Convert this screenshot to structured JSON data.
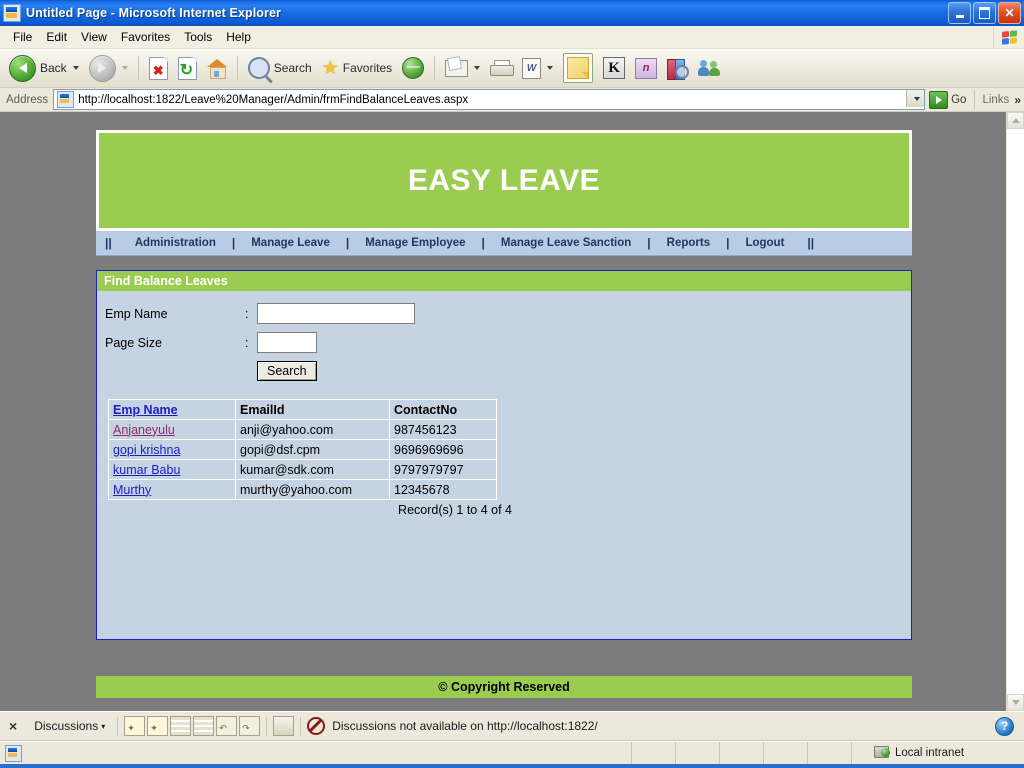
{
  "window": {
    "title": "Untitled Page - Microsoft Internet Explorer",
    "minimize_label": "Minimize",
    "maximize_label": "Maximize",
    "close_label": "Close"
  },
  "menu": {
    "items": [
      "File",
      "Edit",
      "View",
      "Favorites",
      "Tools",
      "Help"
    ]
  },
  "toolbar": {
    "back_label": "Back",
    "search_label": "Search",
    "favorites_label": "Favorites"
  },
  "address": {
    "label": "Address",
    "value": "http://localhost:1822/Leave%20Manager/Admin/frmFindBalanceLeaves.aspx",
    "placeholder": "",
    "go_label": "Go",
    "links_label": "Links",
    "chevron": "»"
  },
  "site": {
    "banner_title": "EASY LEAVE",
    "nav": {
      "start_marker": "||",
      "end_marker": "||",
      "separator": "|",
      "items": [
        "Administration",
        "Manage Leave",
        "Manage Employee",
        "Manage Leave Sanction",
        "Reports",
        "Logout"
      ]
    },
    "panel": {
      "title": "Find Balance Leaves",
      "fields": [
        {
          "label": "Emp Name",
          "colon": ":",
          "value": "",
          "placeholder": ""
        },
        {
          "label": "Page Size",
          "colon": ":",
          "value": "",
          "placeholder": ""
        }
      ],
      "search_button": "Search",
      "grid": {
        "headers": [
          "Emp Name",
          "EmailId",
          "ContactNo"
        ],
        "rows": [
          {
            "name": "Anjaneyulu",
            "email": "anji@yahoo.com",
            "contact": "987456123",
            "visited": true
          },
          {
            "name": "gopi krishna",
            "email": "gopi@dsf.cpm",
            "contact": "9696969696",
            "visited": false
          },
          {
            "name": "kumar Babu",
            "email": "kumar@sdk.com",
            "contact": "9797979797",
            "visited": false
          },
          {
            "name": "Murthy",
            "email": "murthy@yahoo.com",
            "contact": "12345678",
            "visited": false
          }
        ],
        "record_info": "Record(s) 1 to 4 of 4"
      }
    },
    "footer": "© Copyright Reserved"
  },
  "discussion_bar": {
    "close_label": "×",
    "menu_label": "Discussions",
    "menu_caret": "▾",
    "status_text": "Discussions not available on http://localhost:1822/",
    "help_label": "?"
  },
  "statusbar": {
    "message": "",
    "zone": "Local intranet"
  },
  "colors": {
    "brand_green": "#9ACD4F",
    "nav_blue": "#B8CCE4",
    "panel_bg": "#C5D3E2",
    "panel_border": "#2020C0",
    "page_bg": "#7C7C7C",
    "link": "#2020C0",
    "visited_link": "#922B6E",
    "titlebar": "#1B6FE8"
  }
}
